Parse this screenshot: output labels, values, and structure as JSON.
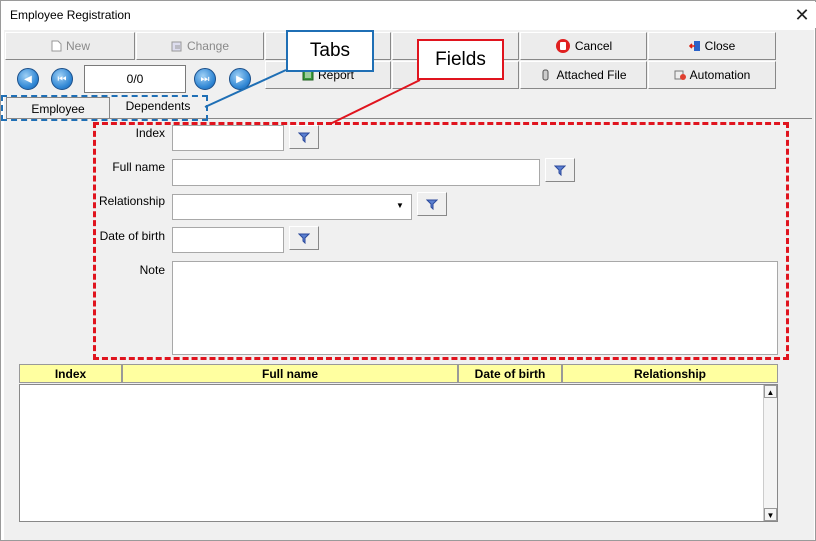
{
  "window": {
    "title": "Employee Registration",
    "close_glyph": "✕"
  },
  "toolbar": {
    "new_label": "New",
    "change_label": "Change",
    "report_label": "Report",
    "cancel_label": "Cancel",
    "close_label": "Close",
    "attached_file_label": "Attached File",
    "automation_label": "Automation",
    "record_counter": "0/0"
  },
  "tabs": [
    {
      "label": "Employee"
    },
    {
      "label": "Dependents"
    }
  ],
  "form": {
    "index_label": "Index",
    "fullname_label": "Full name",
    "relationship_label": "Relationship",
    "dob_label": "Date of birth",
    "note_label": "Note",
    "index_value": "",
    "fullname_value": "",
    "relationship_value": "",
    "dob_value": "",
    "note_value": ""
  },
  "grid": {
    "columns": [
      "Index",
      "Full name",
      "Date of birth",
      "Relationship"
    ],
    "rows": []
  },
  "annotations": {
    "tabs_label": "Tabs",
    "fields_label": "Fields"
  },
  "colors": {
    "tabs_callout": "#1f6fb5",
    "fields_callout": "#e0141e",
    "grid_header": "#ffffa0"
  }
}
